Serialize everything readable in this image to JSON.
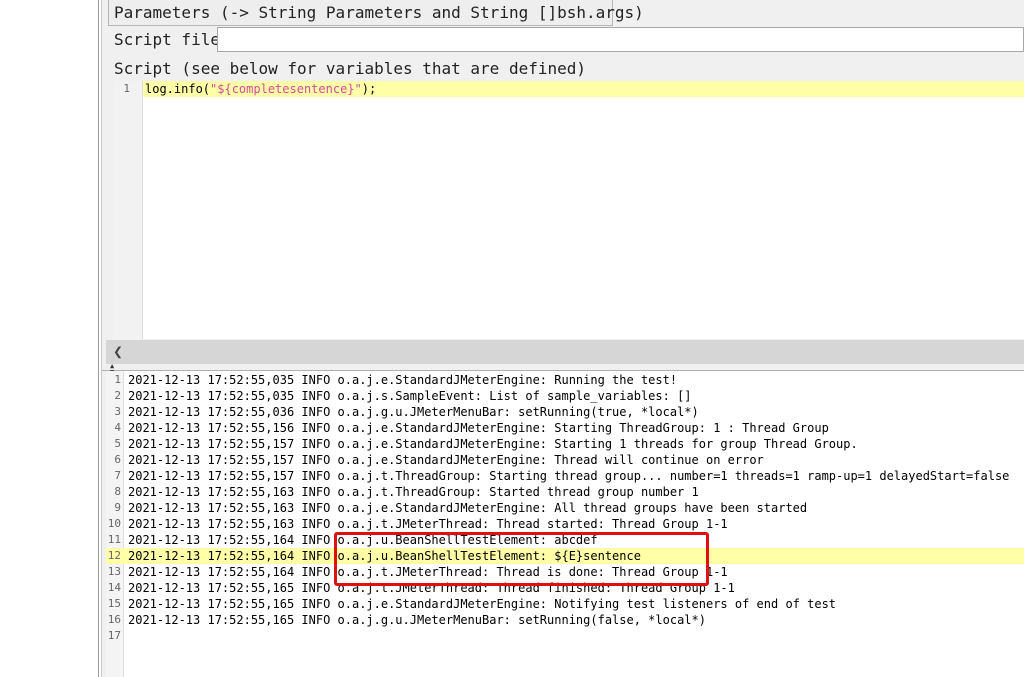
{
  "parameters_tab": {
    "label": "Parameters (-> String Parameters and String []bsh.args)"
  },
  "script_file": {
    "label": "Script file",
    "value": ""
  },
  "script_section": {
    "label": "Script (see below for variables that are defined)"
  },
  "editor": {
    "lines": [
      {
        "number": "1",
        "prefix": "log.info(",
        "string": "\"${completesentence}\"",
        "suffix": ");"
      }
    ]
  },
  "scrollbar": {
    "left_icon": "chevron-left-icon"
  },
  "log": {
    "lines": [
      {
        "number": "1",
        "text": "2021-12-13 17:52:55,035 INFO o.a.j.e.StandardJMeterEngine: Running the test!"
      },
      {
        "number": "2",
        "text": "2021-12-13 17:52:55,035 INFO o.a.j.s.SampleEvent: List of sample_variables: []"
      },
      {
        "number": "3",
        "text": "2021-12-13 17:52:55,036 INFO o.a.j.g.u.JMeterMenuBar: setRunning(true, *local*)"
      },
      {
        "number": "4",
        "text": "2021-12-13 17:52:55,156 INFO o.a.j.e.StandardJMeterEngine: Starting ThreadGroup: 1 : Thread Group"
      },
      {
        "number": "5",
        "text": "2021-12-13 17:52:55,157 INFO o.a.j.e.StandardJMeterEngine: Starting 1 threads for group Thread Group."
      },
      {
        "number": "6",
        "text": "2021-12-13 17:52:55,157 INFO o.a.j.e.StandardJMeterEngine: Thread will continue on error"
      },
      {
        "number": "7",
        "text": "2021-12-13 17:52:55,157 INFO o.a.j.t.ThreadGroup: Starting thread group... number=1 threads=1 ramp-up=1 delayedStart=false"
      },
      {
        "number": "8",
        "text": "2021-12-13 17:52:55,163 INFO o.a.j.t.ThreadGroup: Started thread group number 1"
      },
      {
        "number": "9",
        "text": "2021-12-13 17:52:55,163 INFO o.a.j.e.StandardJMeterEngine: All thread groups have been started"
      },
      {
        "number": "10",
        "text": "2021-12-13 17:52:55,163 INFO o.a.j.t.JMeterThread: Thread started: Thread Group 1-1"
      },
      {
        "number": "11",
        "text": "2021-12-13 17:52:55,164 INFO o.a.j.u.BeanShellTestElement: abcdef"
      },
      {
        "number": "12",
        "text": "2021-12-13 17:52:55,164 INFO o.a.j.u.BeanShellTestElement: ${E}sentence"
      },
      {
        "number": "13",
        "text": "2021-12-13 17:52:55,164 INFO o.a.j.t.JMeterThread: Thread is done: Thread Group 1-1"
      },
      {
        "number": "14",
        "text": "2021-12-13 17:52:55,165 INFO o.a.j.t.JMeterThread: Thread finished: Thread Group 1-1"
      },
      {
        "number": "15",
        "text": "2021-12-13 17:52:55,165 INFO o.a.j.e.StandardJMeterEngine: Notifying test listeners of end of test"
      },
      {
        "number": "16",
        "text": "2021-12-13 17:52:55,165 INFO o.a.j.g.u.JMeterMenuBar: setRunning(false, *local*)"
      },
      {
        "number": "17",
        "text": ""
      }
    ],
    "highlighted_line": "12"
  },
  "colors": {
    "highlight": "#ffffa8",
    "annotation_box": "#e01010",
    "string_literal": "#d14b9b"
  }
}
